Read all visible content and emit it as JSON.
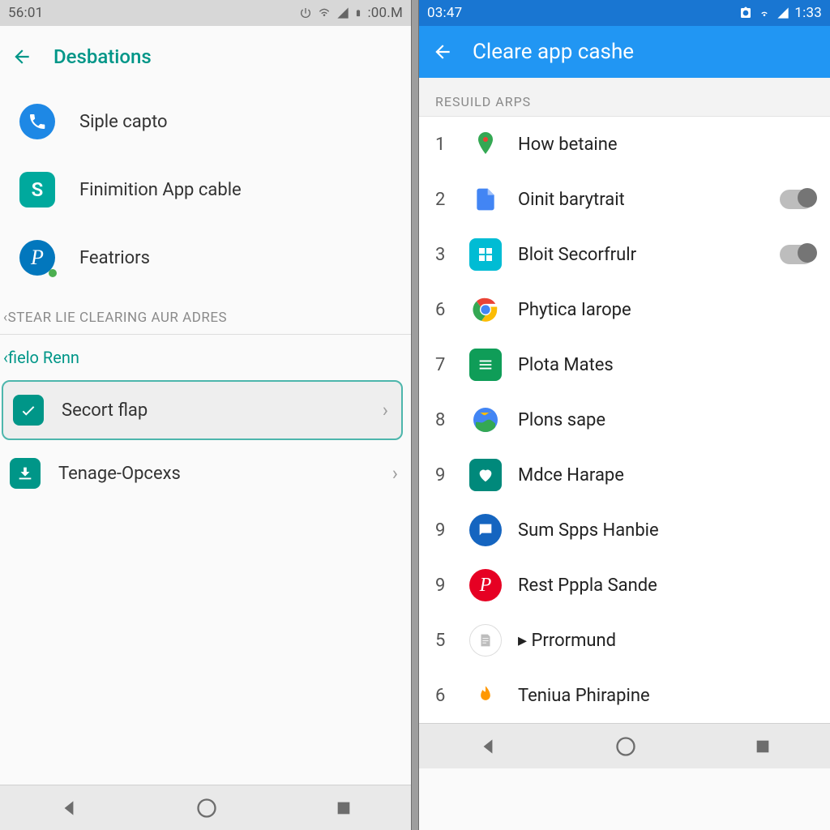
{
  "left": {
    "status_time": "56:01",
    "status_right_text": ":00.M",
    "title": "Desbations",
    "entries": [
      {
        "label": "Siple capto"
      },
      {
        "label": "Finimition App cable"
      },
      {
        "label": "Featriors"
      }
    ],
    "section_caption": "‹STEAR LIE CLEARING AUR ADRES",
    "link_caption": "‹fielo Renn",
    "rows": [
      {
        "label": "Secort flap"
      },
      {
        "label": "Tenage-Opcexs"
      }
    ]
  },
  "right": {
    "status_time": "03:47",
    "status_right_text": "1:33",
    "title": "Cleare app cashe",
    "section_caption": "RESUILD ARPS",
    "apps": [
      {
        "num": "1",
        "name": "How betaine",
        "toggle": false
      },
      {
        "num": "2",
        "name": "Oinit barytrait",
        "toggle": true
      },
      {
        "num": "3",
        "name": "Bloit Secorfrulr",
        "toggle": true
      },
      {
        "num": "6",
        "name": "Phytica Iarope",
        "toggle": false
      },
      {
        "num": "7",
        "name": "Plota Mates",
        "toggle": false
      },
      {
        "num": "8",
        "name": "Plons sape",
        "toggle": false
      },
      {
        "num": "9",
        "name": "Mdce Harape",
        "toggle": false
      },
      {
        "num": "9",
        "name": "Sum Spps Hanbie",
        "toggle": false
      },
      {
        "num": "9",
        "name": "Rest Pppla Sande",
        "toggle": false
      },
      {
        "num": "5",
        "name": "▸ Prrormund",
        "toggle": false
      },
      {
        "num": "6",
        "name": "Teniua Phirapine",
        "toggle": false
      }
    ]
  }
}
